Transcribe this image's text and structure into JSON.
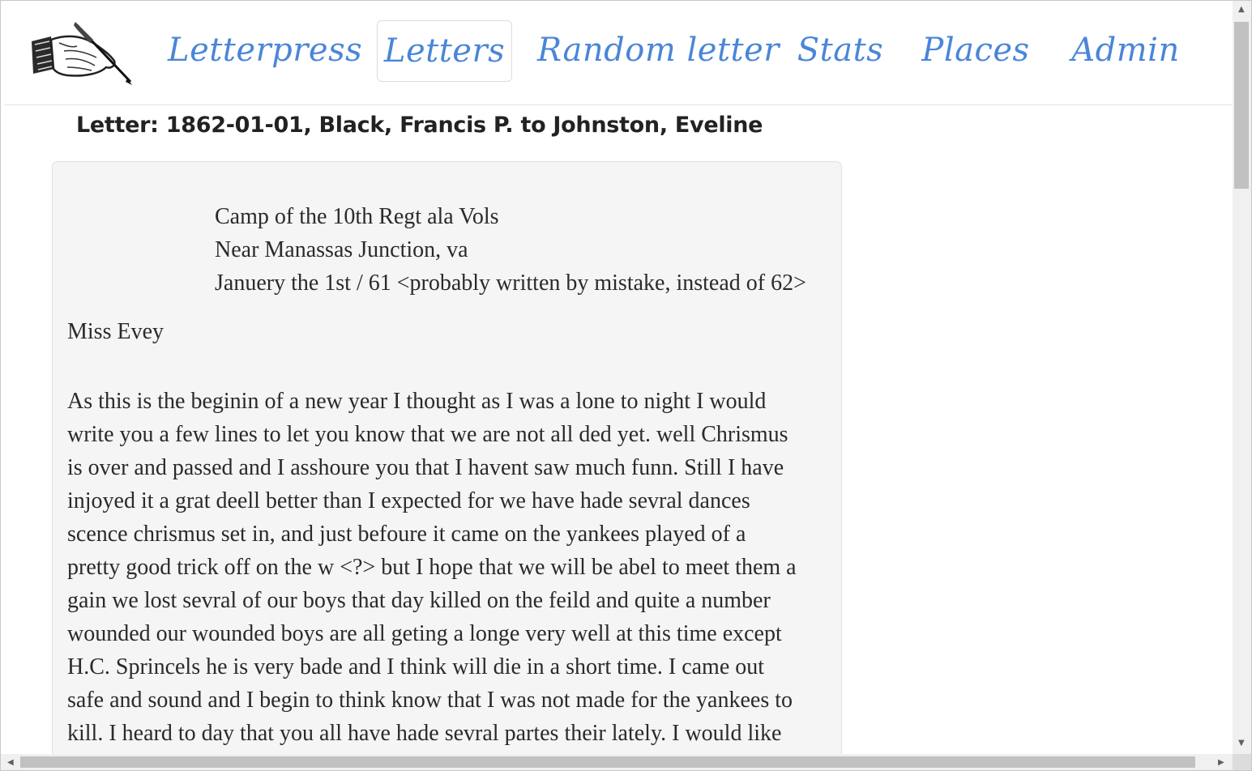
{
  "nav": {
    "logo_alt": "hand-writing-with-quill",
    "items": [
      {
        "label": "Letterpress",
        "active": false
      },
      {
        "label": "Letters",
        "active": true
      },
      {
        "label": "Random letter",
        "active": false
      },
      {
        "label": "Stats",
        "active": false
      },
      {
        "label": "Places",
        "active": false
      },
      {
        "label": "Admin",
        "active": false
      }
    ],
    "link_color": "#4a86d8"
  },
  "page": {
    "title": "Letter: 1862-01-01, Black, Francis P. to Johnston, Eveline"
  },
  "letter": {
    "address_lines": [
      "Camp of the 10th Regt ala Vols",
      "Near Manassas Junction, va",
      "Januery the 1st / 61 <probably written by mistake, instead of 62>"
    ],
    "salutation": "Miss Evey",
    "body_lines": [
      "As this is the beginin of a new year I thought as I was a lone to night I would",
      "write you a few lines to let you know that we are not all ded yet. well Chrismus",
      "is over and passed and I asshoure you that I havent saw much funn. Still I have",
      "injoyed it a grat deell better than I expected for we have hade sevral dances",
      "scence chrismus set in, and just befoure it came on the yankees played of a",
      "pretty good trick off on the w <?> but I hope that we will be abel to meet them a",
      "gain we lost sevral of our boys that day killed on the feild and quite a number",
      "wounded our wounded boys are all geting a longe very well at this time except",
      "H.C. Sprincels he is very bade and I think will die in a short time. I came out",
      "safe and sound and I begin to think know that I was not made for the yankees to",
      "kill. I heard to day that you all have hade sevral partes their lately. I would like"
    ]
  }
}
